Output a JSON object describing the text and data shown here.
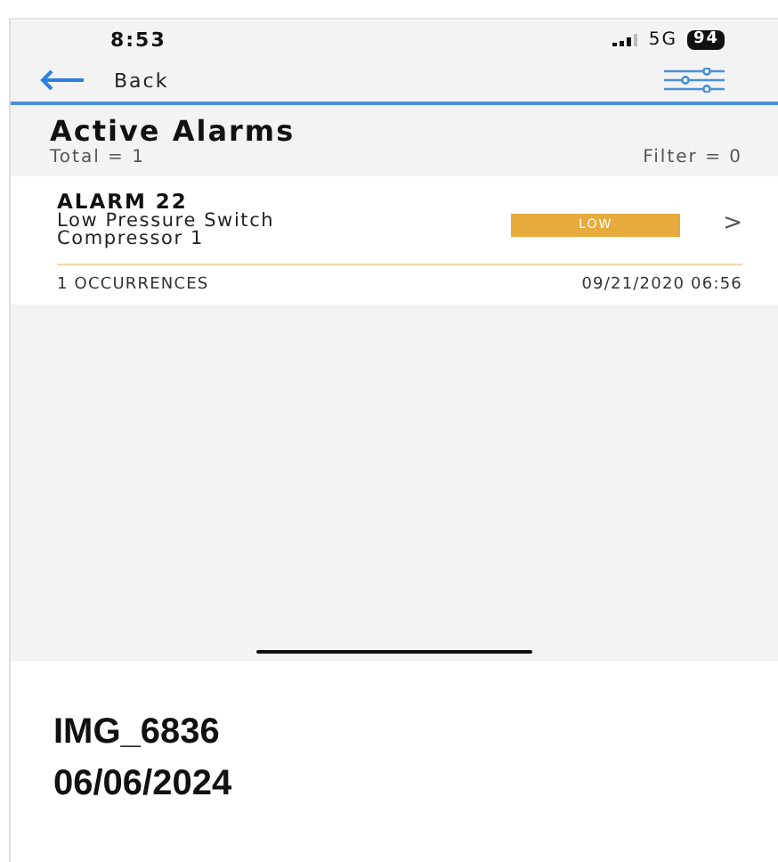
{
  "status_bar": {
    "time": "8:53",
    "network": "5G",
    "battery": "94"
  },
  "nav": {
    "back_label": "Back"
  },
  "header": {
    "title": "Active Alarms",
    "total": "Total = 1",
    "filter": "Filter = 0"
  },
  "alarms": [
    {
      "name": "ALARM 22",
      "description": [
        "Low Pressure Switch",
        "Compressor 1"
      ],
      "severity": "LOW",
      "color": "#e6ab3c",
      "chevron": ">",
      "occurrences": "1 OCCURRENCES",
      "timestamp": "09/21/2020 06:56"
    }
  ],
  "caption": {
    "filename": "IMG_6836",
    "date": "06/06/2024"
  }
}
